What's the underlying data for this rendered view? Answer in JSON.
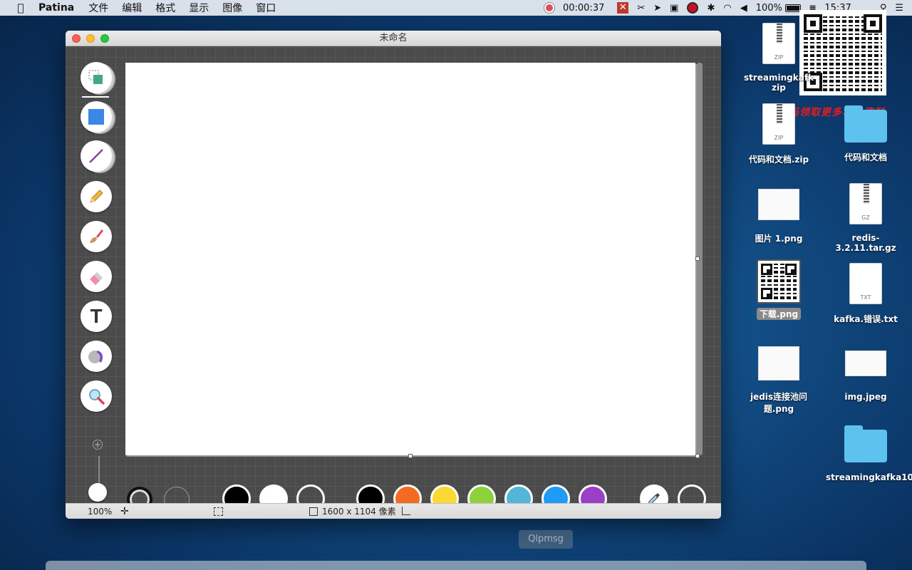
{
  "menubar": {
    "app_name": "Patina",
    "menus": [
      "文件",
      "编辑",
      "格式",
      "显示",
      "图像",
      "窗口"
    ],
    "timer": "00:00:37",
    "battery": "100%",
    "clock": "15:37"
  },
  "window": {
    "title": "未命名",
    "status": {
      "zoom": "100%",
      "size": "1600 x 1104 像素"
    }
  },
  "tools": [
    {
      "name": "select-tool",
      "icon": "selection-icon"
    },
    {
      "name": "shape-tool",
      "icon": "square-icon"
    },
    {
      "name": "line-tool",
      "icon": "line-icon"
    },
    {
      "name": "pencil-tool",
      "icon": "pencil-icon"
    },
    {
      "name": "brush-tool",
      "icon": "brush-icon"
    },
    {
      "name": "eraser-tool",
      "icon": "eraser-icon"
    },
    {
      "name": "text-tool",
      "icon": "text-icon",
      "glyph": "T"
    },
    {
      "name": "fill-tool",
      "icon": "paint-bucket-icon"
    },
    {
      "name": "zoom-tool",
      "icon": "magnifier-icon"
    }
  ],
  "palette": {
    "colors": [
      "#000000",
      "#f26b22",
      "#fbd932",
      "#8ed23b",
      "#55b5d9",
      "#1e9cf5",
      "#9b3fc7"
    ],
    "fill_colors": [
      "#000000",
      "#ffffff",
      "transparent"
    ]
  },
  "desktop": {
    "promo": "扫码领取更多项目资料",
    "icons": [
      {
        "label": "streamingkafka.zip",
        "line1": "streamingkafk",
        "line2": "zip",
        "ext": "ZIP"
      },
      {
        "label": "代码和文档.zip",
        "ext": "ZIP"
      },
      {
        "label": "代码和文档"
      },
      {
        "label": "图片 1.png"
      },
      {
        "label": "redis-3.2.11.tar.gz",
        "ext": "GZ"
      },
      {
        "label": "下载.png"
      },
      {
        "label": "kafka.错误.txt",
        "ext": "TXT"
      },
      {
        "label": "jedis连接池问题.png",
        "line1": "jedis连接池问",
        "line2": "题.png"
      },
      {
        "label": "img.jpeg"
      },
      {
        "label": "streamingkafka10"
      }
    ]
  },
  "dock_tooltip": "Qlpmsg"
}
